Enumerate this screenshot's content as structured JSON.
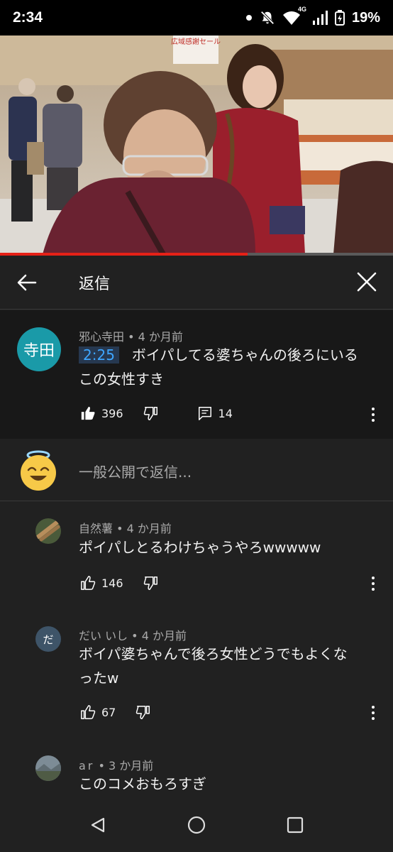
{
  "status_bar": {
    "time": "2:34",
    "network": "4G",
    "battery": "19%"
  },
  "video": {
    "banner_text": "広域感謝セール",
    "progress": 0.63,
    "progress_color": "#e62117"
  },
  "header": {
    "title": "返信"
  },
  "main_comment": {
    "avatar_text": "寺田",
    "avatar_color": "#1a9aa8",
    "author": "邪心寺田",
    "time": "4 か月前",
    "timestamp_link": "2:25",
    "text_line1": "ボイパしてる婆ちゃんの後ろにいる",
    "text_line2": "この女性すき",
    "likes": "396",
    "replies": "14"
  },
  "add_reply": {
    "placeholder": "一般公開で返信..."
  },
  "replies": [
    {
      "author": "自然薯",
      "time": "4 か月前",
      "text": "ポイパしとるわけちゃうやろwwwww",
      "likes": "146"
    },
    {
      "author": "だい いし",
      "avatar_text": "だ",
      "time": "4 か月前",
      "text_line1": "ボイパ婆ちゃんで後ろ女性どうでもよくな",
      "text_line2": "ったw",
      "likes": "67"
    },
    {
      "author": "ar",
      "time": "3 か月前",
      "text": "このコメおもろすぎ"
    }
  ]
}
